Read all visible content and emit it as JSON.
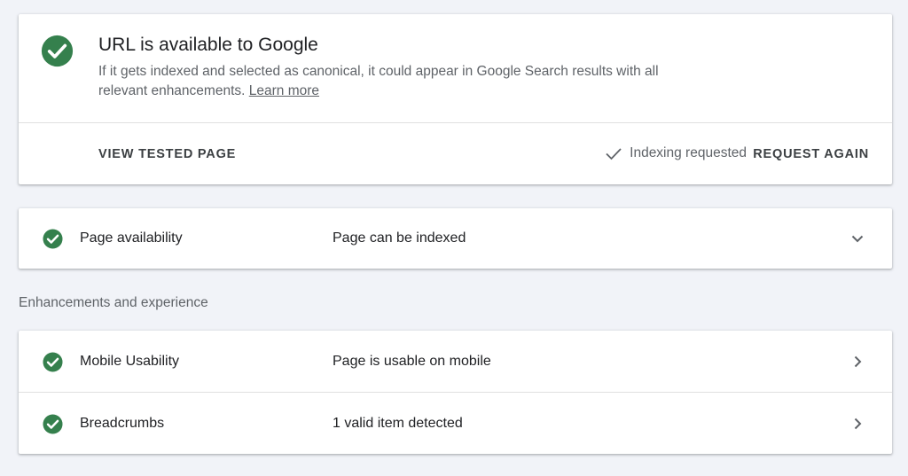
{
  "status": {
    "title": "URL is available to Google",
    "description": "If it gets indexed and selected as canonical, it could appear in Google Search results with all relevant enhancements.",
    "learn_more": "Learn more",
    "view_tested_page": "VIEW TESTED PAGE",
    "indexing_requested": "Indexing requested",
    "request_again": "REQUEST AGAIN"
  },
  "availability": {
    "label": "Page availability",
    "value": "Page can be indexed"
  },
  "enhancements": {
    "heading": "Enhancements and experience",
    "items": [
      {
        "label": "Mobile Usability",
        "value": "Page is usable on mobile"
      },
      {
        "label": "Breadcrumbs",
        "value": "1 valid item detected"
      }
    ]
  },
  "colors": {
    "success_green": "#34a853",
    "check_green": "#1e8e3e",
    "background": "#f1f3f8"
  },
  "icons": {
    "status": "check-circle-icon",
    "expand": "chevron-down-icon",
    "navigate": "chevron-right-icon",
    "requested": "checkmark-icon"
  }
}
